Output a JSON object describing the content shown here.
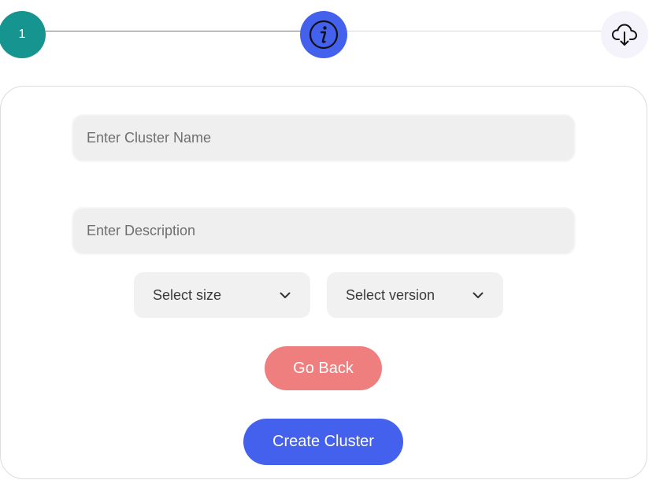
{
  "stepper": {
    "step1_label": "1",
    "step2_icon": "info-icon",
    "step3_icon": "cloud-download-icon",
    "completed_color": "#16948f",
    "active_color": "#4461ee",
    "inactive_color": "#f4f3fb"
  },
  "form": {
    "cluster_name_placeholder": "Enter Cluster Name",
    "cluster_name_value": "",
    "description_placeholder": "Enter Description",
    "description_value": "",
    "size_select_value": "Select size",
    "version_select_value": "Select version"
  },
  "buttons": {
    "go_back_label": "Go Back",
    "go_back_color": "#ef7e7e",
    "create_label": "Create Cluster",
    "create_color": "#4461ee"
  }
}
